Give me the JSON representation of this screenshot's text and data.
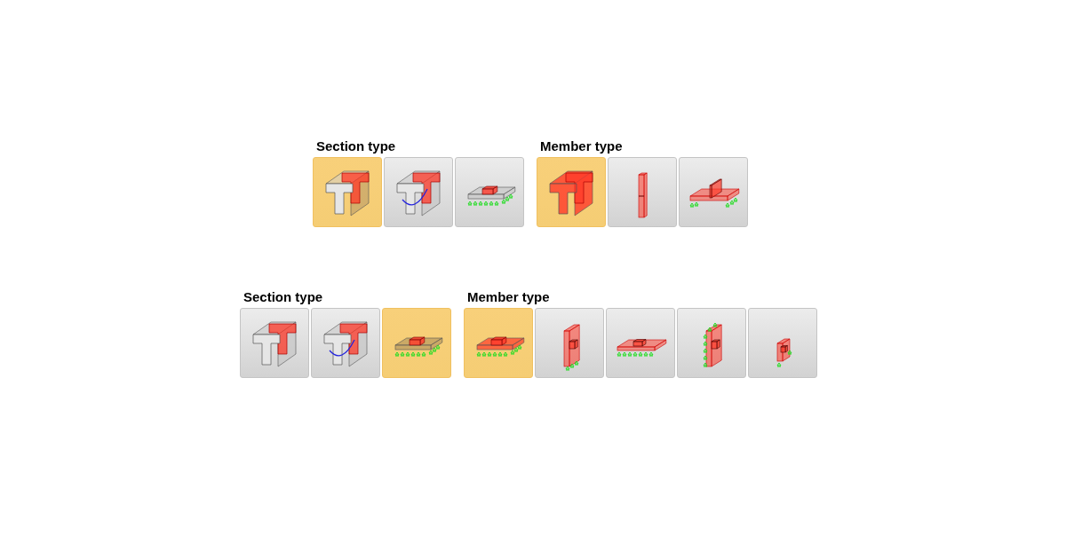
{
  "panels": [
    {
      "groups": [
        {
          "title": "Section type",
          "buttons": [
            {
              "kind": "tsection",
              "selected": true
            },
            {
              "kind": "tcurve",
              "selected": false
            },
            {
              "kind": "slabsection",
              "selected": false
            }
          ]
        },
        {
          "title": "Member type",
          "buttons": [
            {
              "kind": "tbeam",
              "selected": true
            },
            {
              "kind": "column",
              "selected": false
            },
            {
              "kind": "ribslab",
              "selected": false
            }
          ]
        }
      ]
    },
    {
      "groups": [
        {
          "title": "Section type",
          "buttons": [
            {
              "kind": "tsection",
              "selected": false
            },
            {
              "kind": "tcurve",
              "selected": false
            },
            {
              "kind": "slabsection",
              "selected": true
            }
          ]
        },
        {
          "title": "Member type",
          "buttons": [
            {
              "kind": "slab",
              "selected": true
            },
            {
              "kind": "wall",
              "selected": false
            },
            {
              "kind": "plate",
              "selected": false
            },
            {
              "kind": "edgewall",
              "selected": false
            },
            {
              "kind": "panel",
              "selected": false
            }
          ]
        }
      ]
    }
  ]
}
